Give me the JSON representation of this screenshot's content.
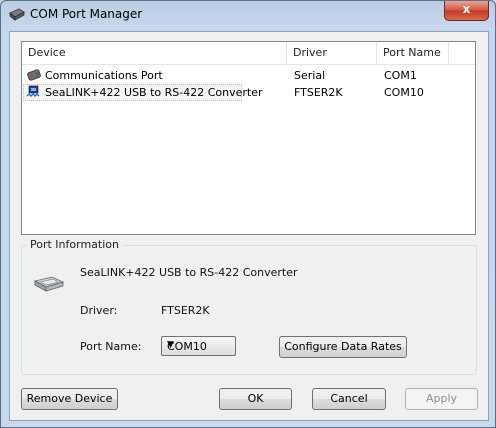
{
  "window": {
    "title": "COM Port Manager",
    "close_glyph": "x"
  },
  "list": {
    "columns": [
      "Device",
      "Driver",
      "Port Name"
    ],
    "rows": [
      {
        "device": "Communications Port",
        "driver": "Serial",
        "port": "COM1",
        "icon": "serial-port-icon"
      },
      {
        "device": "SeaLINK+422 USB to RS-422 Converter",
        "driver": "FTSER2K",
        "port": "COM10",
        "icon": "usb-serial-icon"
      }
    ]
  },
  "port_info": {
    "group_title": "Port Information",
    "device_name": "SeaLINK+422 USB to RS-422 Converter",
    "driver_label": "Driver:",
    "driver_value": "FTSER2K",
    "port_name_label": "Port Name:",
    "port_name_value": "COM10",
    "configure_label": "Configure Data Rates"
  },
  "buttons": {
    "remove": "Remove Device",
    "ok": "OK",
    "cancel": "Cancel",
    "apply": "Apply"
  },
  "colors": {
    "close_button": "#c23b22",
    "selection_band": "#f3f3f3"
  }
}
